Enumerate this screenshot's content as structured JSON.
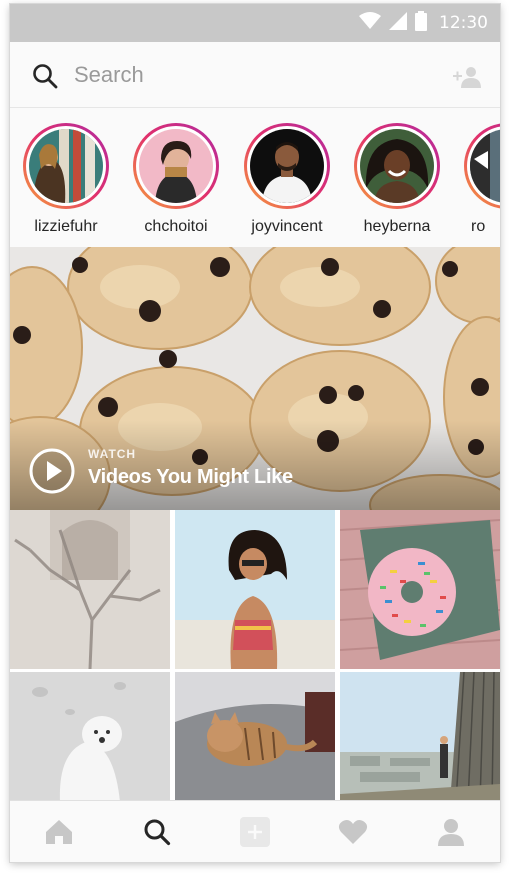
{
  "status_bar": {
    "time": "12:30",
    "icons": [
      "wifi-icon",
      "cell-signal-icon",
      "battery-icon"
    ]
  },
  "search": {
    "placeholder": "Search",
    "icon": "search-icon",
    "action_icon": "add-person-icon"
  },
  "stories": [
    {
      "username": "lizziefuhr"
    },
    {
      "username": "chchoitoi"
    },
    {
      "username": "joyvincent"
    },
    {
      "username": "heyberna"
    },
    {
      "username": "ro"
    }
  ],
  "featured": {
    "label": "WATCH",
    "title": "Videos You Might Like",
    "icon": "play-icon"
  },
  "grid_photos": [
    {
      "subject": "tree-shadow-photo"
    },
    {
      "subject": "woman-beach-photo"
    },
    {
      "subject": "sprinkle-donut-photo"
    },
    {
      "subject": "white-dog-photo"
    },
    {
      "subject": "cat-on-bed-photo"
    },
    {
      "subject": "city-overlook-photo"
    }
  ],
  "bottom_nav": [
    {
      "name": "home-icon",
      "active": false
    },
    {
      "name": "search-icon",
      "active": true
    },
    {
      "name": "add-post-icon",
      "active": false
    },
    {
      "name": "heart-icon",
      "active": false
    },
    {
      "name": "profile-icon",
      "active": false
    }
  ],
  "colors": {
    "story_ring_start": "#f7a33a",
    "story_ring_end": "#b02aa3",
    "status_bar": "#c8c8c8",
    "nav_inactive": "#c7c7c7",
    "nav_active": "#262626"
  }
}
